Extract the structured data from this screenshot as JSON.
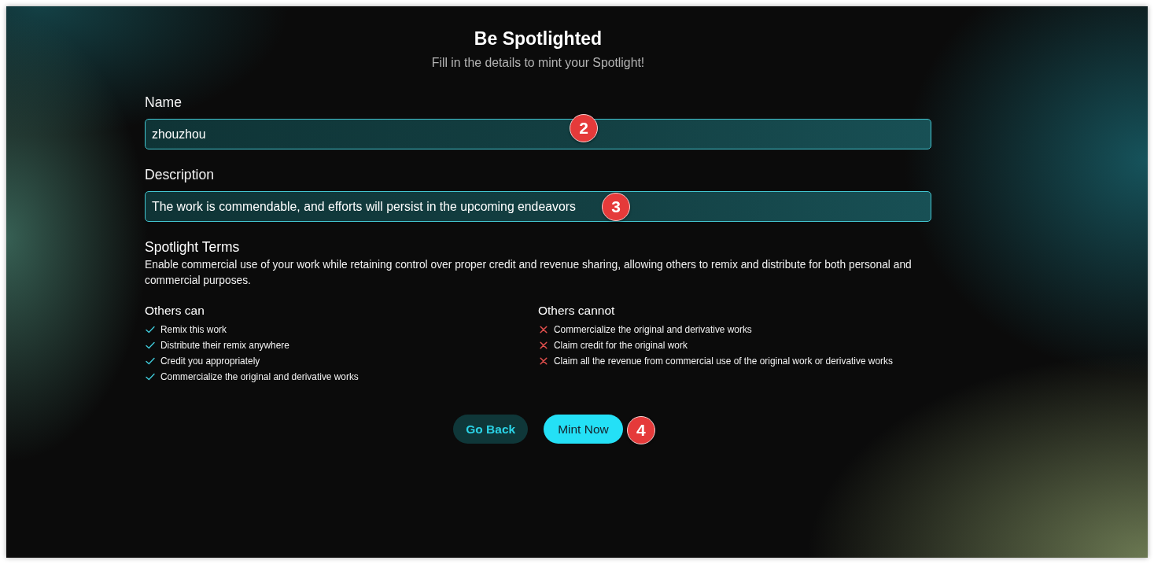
{
  "header": {
    "title": "Be Spotlighted",
    "subtitle": "Fill in the details to mint your Spotlight!"
  },
  "fields": [
    {
      "label": "Name",
      "value": "zhouzhou",
      "marker": "2"
    },
    {
      "label": "Description",
      "value": "The work is commendable, and efforts will persist in the upcoming endeavors",
      "marker": "3"
    }
  ],
  "terms": {
    "title": "Spotlight Terms",
    "description": "Enable commercial use of your work while retaining control over proper credit and revenue sharing, allowing others to remix and distribute for both personal and commercial purposes."
  },
  "permissions": [
    {
      "heading": "Others can",
      "kind": "allowed",
      "items": [
        "Remix this work",
        "Distribute their remix anywhere",
        "Credit you appropriately",
        "Commercialize the original and derivative works"
      ]
    },
    {
      "heading": "Others cannot",
      "kind": "denied",
      "items": [
        "Commercialize the original and derivative works",
        "Claim credit for the original work",
        "Claim all the revenue from commercial use of the original work or derivative works"
      ]
    }
  ],
  "buttons": [
    {
      "label": "Go Back",
      "kind": "secondary"
    },
    {
      "label": "Mint Now",
      "kind": "primary",
      "marker": "4"
    }
  ]
}
